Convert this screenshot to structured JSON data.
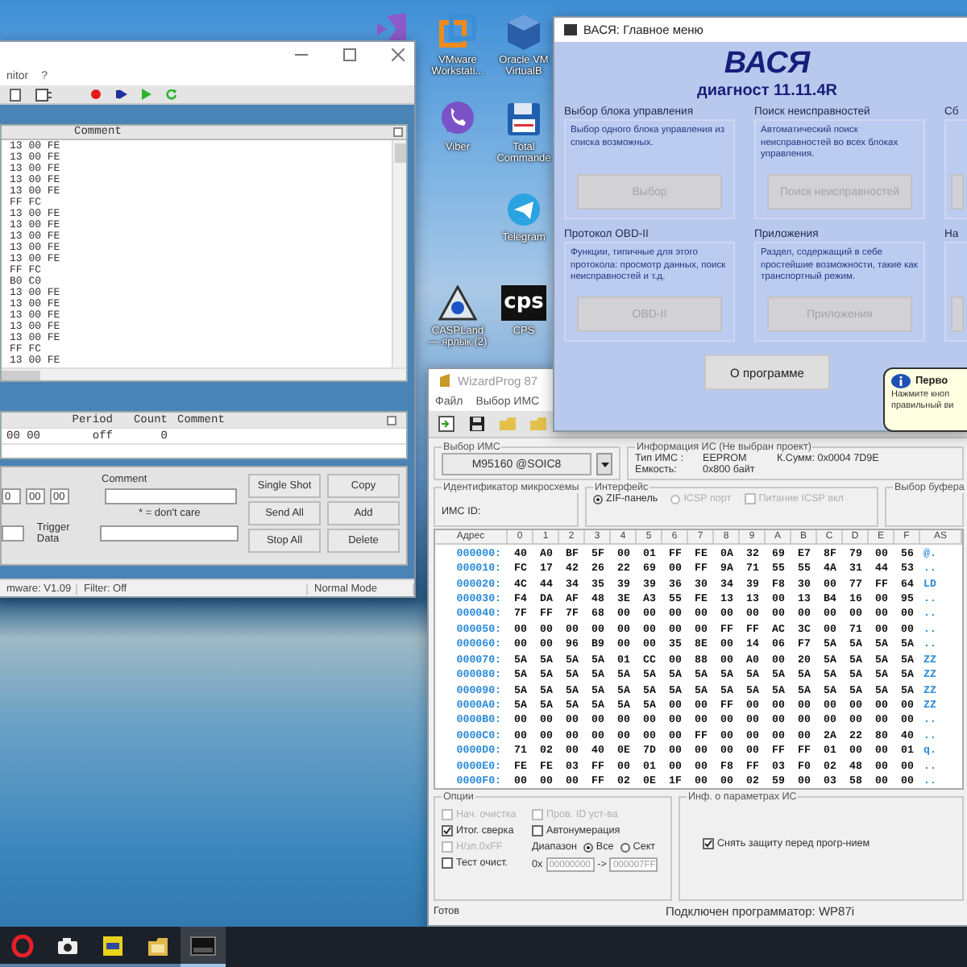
{
  "desktop_icons": [
    {
      "kind": "ribbon"
    },
    {
      "kind": "squares",
      "label": "VMware Workstati..."
    },
    {
      "kind": "bubble",
      "label": "Viber"
    },
    {
      "kind": "triangle",
      "label": "CASPLand — ярлык (2)"
    },
    {
      "kind": "cube",
      "label": "Oracle VM VirtualB"
    },
    {
      "kind": "floppy",
      "label": "Total Commande"
    },
    {
      "kind": "plane",
      "label": "Telegram"
    },
    {
      "kind": "logo",
      "logo_text": "cps",
      "label": "CPS"
    }
  ],
  "can_window": {
    "menu": [
      "nitor",
      "?"
    ],
    "log_header": "Comment",
    "log_rows": [
      "13 00 FE",
      "13 00 FE",
      "13 00 FE",
      "13 00 FE",
      "13 00 FE",
      "FF FC",
      "13 00 FE",
      "13 00 FE",
      "13 00 FE",
      "13 00 FE",
      "13 00 FE",
      "FF FC",
      "B0 C0",
      "13 00 FE",
      "13 00 FE",
      "13 00 FE",
      "13 00 FE",
      "13 00 FE",
      "FF FC",
      "13 00 FE"
    ],
    "tx_columns": [
      "Period",
      "Count",
      "Comment"
    ],
    "tx_rows": [
      {
        "data": "00 00",
        "period": "off",
        "count": "0"
      }
    ],
    "data_bytes": [
      "0",
      "00",
      "00"
    ],
    "comment_label": "Comment",
    "dont_care_note": "* = don't care",
    "trigger_label": "Trigger Data",
    "buttons": [
      "Single Shot",
      "Copy",
      "Send All",
      "Add",
      "Stop All",
      "Delete"
    ],
    "status": [
      "mware: V1.09",
      "Filter: Off",
      "Normal Mode"
    ]
  },
  "vasya_window": {
    "title": "ВАСЯ: Главное меню",
    "app_name": "ВАСЯ",
    "version": "диагност 11.11.4R",
    "groups": [
      {
        "title": "Выбор блока управления",
        "description": "Выбор одного блока управления из списка возможных.",
        "button": "Выбор",
        "disabled": true
      },
      {
        "title": "Поиск неисправностей",
        "description": "Автоматический поиск неисправностей во всех блоках управления.",
        "button": "Поиск неисправностей",
        "disabled": true
      },
      {
        "title": "Сб",
        "disabled": true
      },
      {
        "title": "Протокол OBD-II",
        "description": "Функции, типичные для этого протокола: просмотр данных, поиск неисправностей и т.д.",
        "button": "OBD-II",
        "disabled": true
      },
      {
        "title": "Приложения",
        "description": "Раздел, содержащий в себе простейшие возможности, такие как транспортный режим.",
        "button": "Приложения",
        "disabled": true
      },
      {
        "title": "На",
        "disabled": true
      }
    ],
    "about_button": "О программе",
    "balloon": {
      "title": "Перво",
      "lines": [
        "Нажмите кноп",
        "правильный ви"
      ]
    }
  },
  "wizard_window": {
    "title": "WizardProg 87",
    "menu": [
      "Файл",
      "Выбор ИМС"
    ],
    "chip_group": "Выбор ИМС",
    "chip": "M95160 @SOIC8",
    "info_group": "Информация ИС (Не выбран проект)",
    "info_lines": [
      [
        "Тип ИМС :",
        "EEPROM",
        "К.Сумм: 0x0004 7D9E"
      ],
      [
        "Емкость:",
        "0x800 байт"
      ]
    ],
    "id_group": "Идентификатор микросхемы",
    "id_label": "ИМС ID:",
    "interface_group": "Интерфейс",
    "interface_options": [
      {
        "kind": "radio",
        "label": "ZIF-панель",
        "selected": true,
        "disabled": false
      },
      {
        "kind": "radio",
        "label": "ICSP порт",
        "selected": false,
        "disabled": true
      },
      {
        "kind": "checkbox",
        "label": "Питание ICSP вкл",
        "checked": false,
        "disabled": true
      }
    ],
    "buffer_group": "Выбор буфера",
    "hex_columns": [
      "Адрес",
      "0",
      "1",
      "2",
      "3",
      "4",
      "5",
      "6",
      "7",
      "8",
      "9",
      "A",
      "B",
      "C",
      "D",
      "E",
      "F",
      "AS"
    ],
    "hex_rows": [
      {
        "address": "000000:",
        "bytes": [
          "40",
          "A0",
          "BF",
          "5F",
          "00",
          "01",
          "FF",
          "FE",
          "0A",
          "32",
          "69",
          "E7",
          "8F",
          "79",
          "00",
          "56"
        ],
        "ascii": "@."
      },
      {
        "address": "000010:",
        "bytes": [
          "FC",
          "17",
          "42",
          "26",
          "22",
          "69",
          "00",
          "FF",
          "9A",
          "71",
          "55",
          "55",
          "4A",
          "31",
          "44",
          "53"
        ],
        "ascii": ".."
      },
      {
        "address": "000020:",
        "bytes": [
          "4C",
          "44",
          "34",
          "35",
          "39",
          "39",
          "36",
          "30",
          "34",
          "39",
          "F8",
          "30",
          "00",
          "77",
          "FF",
          "64"
        ],
        "ascii": "LD"
      },
      {
        "address": "000030:",
        "bytes": [
          "F4",
          "DA",
          "AF",
          "48",
          "3E",
          "A3",
          "55",
          "FE",
          "13",
          "13",
          "00",
          "13",
          "B4",
          "16",
          "00",
          "95"
        ],
        "ascii": ".."
      },
      {
        "address": "000040:",
        "bytes": [
          "7F",
          "FF",
          "7F",
          "68",
          "00",
          "00",
          "00",
          "00",
          "00",
          "00",
          "00",
          "00",
          "00",
          "00",
          "00",
          "00"
        ],
        "ascii": ".."
      },
      {
        "address": "000050:",
        "bytes": [
          "00",
          "00",
          "00",
          "00",
          "00",
          "00",
          "00",
          "00",
          "FF",
          "FF",
          "AC",
          "3C",
          "00",
          "71",
          "00",
          "00"
        ],
        "ascii": ".."
      },
      {
        "address": "000060:",
        "bytes": [
          "00",
          "00",
          "96",
          "B9",
          "00",
          "00",
          "35",
          "8E",
          "00",
          "14",
          "06",
          "F7",
          "5A",
          "5A",
          "5A",
          "5A"
        ],
        "ascii": ".."
      },
      {
        "address": "000070:",
        "bytes": [
          "5A",
          "5A",
          "5A",
          "5A",
          "01",
          "CC",
          "00",
          "88",
          "00",
          "A0",
          "00",
          "20",
          "5A",
          "5A",
          "5A",
          "5A"
        ],
        "ascii": "ZZ"
      },
      {
        "address": "000080:",
        "bytes": [
          "5A",
          "5A",
          "5A",
          "5A",
          "5A",
          "5A",
          "5A",
          "5A",
          "5A",
          "5A",
          "5A",
          "5A",
          "5A",
          "5A",
          "5A",
          "5A"
        ],
        "ascii": "ZZ"
      },
      {
        "address": "000090:",
        "bytes": [
          "5A",
          "5A",
          "5A",
          "5A",
          "5A",
          "5A",
          "5A",
          "5A",
          "5A",
          "5A",
          "5A",
          "5A",
          "5A",
          "5A",
          "5A",
          "5A"
        ],
        "ascii": "ZZ"
      },
      {
        "address": "0000A0:",
        "bytes": [
          "5A",
          "5A",
          "5A",
          "5A",
          "5A",
          "5A",
          "00",
          "00",
          "FF",
          "00",
          "00",
          "00",
          "00",
          "00",
          "00",
          "00"
        ],
        "ascii": "ZZ"
      },
      {
        "address": "0000B0:",
        "bytes": [
          "00",
          "00",
          "00",
          "00",
          "00",
          "00",
          "00",
          "00",
          "00",
          "00",
          "00",
          "00",
          "00",
          "00",
          "00",
          "00"
        ],
        "ascii": ".."
      },
      {
        "address": "0000C0:",
        "bytes": [
          "00",
          "00",
          "00",
          "00",
          "00",
          "00",
          "00",
          "FF",
          "00",
          "00",
          "00",
          "00",
          "2A",
          "22",
          "80",
          "40"
        ],
        "ascii": ".."
      },
      {
        "address": "0000D0:",
        "bytes": [
          "71",
          "02",
          "00",
          "40",
          "0E",
          "7D",
          "00",
          "00",
          "00",
          "00",
          "FF",
          "FF",
          "01",
          "00",
          "00",
          "01"
        ],
        "ascii": "q."
      },
      {
        "address": "0000E0:",
        "bytes": [
          "FE",
          "FE",
          "03",
          "FF",
          "00",
          "01",
          "00",
          "00",
          "F8",
          "FF",
          "03",
          "F0",
          "02",
          "48",
          "00",
          "00"
        ],
        "ascii": ".."
      },
      {
        "address": "0000F0:",
        "bytes": [
          "00",
          "00",
          "00",
          "FF",
          "02",
          "0E",
          "1F",
          "00",
          "00",
          "02",
          "59",
          "00",
          "03",
          "58",
          "00",
          "00"
        ],
        "ascii": ".."
      }
    ],
    "options_group": "Опции",
    "options_left": [
      {
        "label": "Нач. очистка",
        "checked": false,
        "disabled": true
      },
      {
        "label": "Итог. сверка",
        "checked": true,
        "disabled": false
      },
      {
        "label": "H/зп.0xFF",
        "checked": false,
        "disabled": true
      },
      {
        "label": "Тест очист.",
        "checked": false,
        "disabled": false
      }
    ],
    "options_right": [
      {
        "label": "Пров. ID уст-ва",
        "checked": false,
        "disabled": true
      },
      {
        "label": "Автонумерация",
        "checked": false,
        "disabled": false
      }
    ],
    "range": {
      "label": "Диапазон",
      "choices": [
        {
          "label": "Все",
          "selected": true
        },
        {
          "label": "Сект",
          "selected": false
        }
      ],
      "prefix": "0x",
      "from": "00000000",
      "arrow": "->",
      "to": "000007FF"
    },
    "params_group": "Инф. о параметрах ИС",
    "params_options": [
      {
        "label": "Снять защиту перед прогр-нием",
        "checked": true,
        "disabled": false
      }
    ],
    "status": [
      "Готов",
      "Подключен программатор: WP87i"
    ]
  },
  "taskbar": [
    {
      "kind": "ring",
      "selected": false
    },
    {
      "kind": "camera",
      "selected": false
    },
    {
      "kind": "chip",
      "selected": false
    },
    {
      "kind": "folder",
      "selected": false
    },
    {
      "kind": "window",
      "selected": true
    }
  ]
}
